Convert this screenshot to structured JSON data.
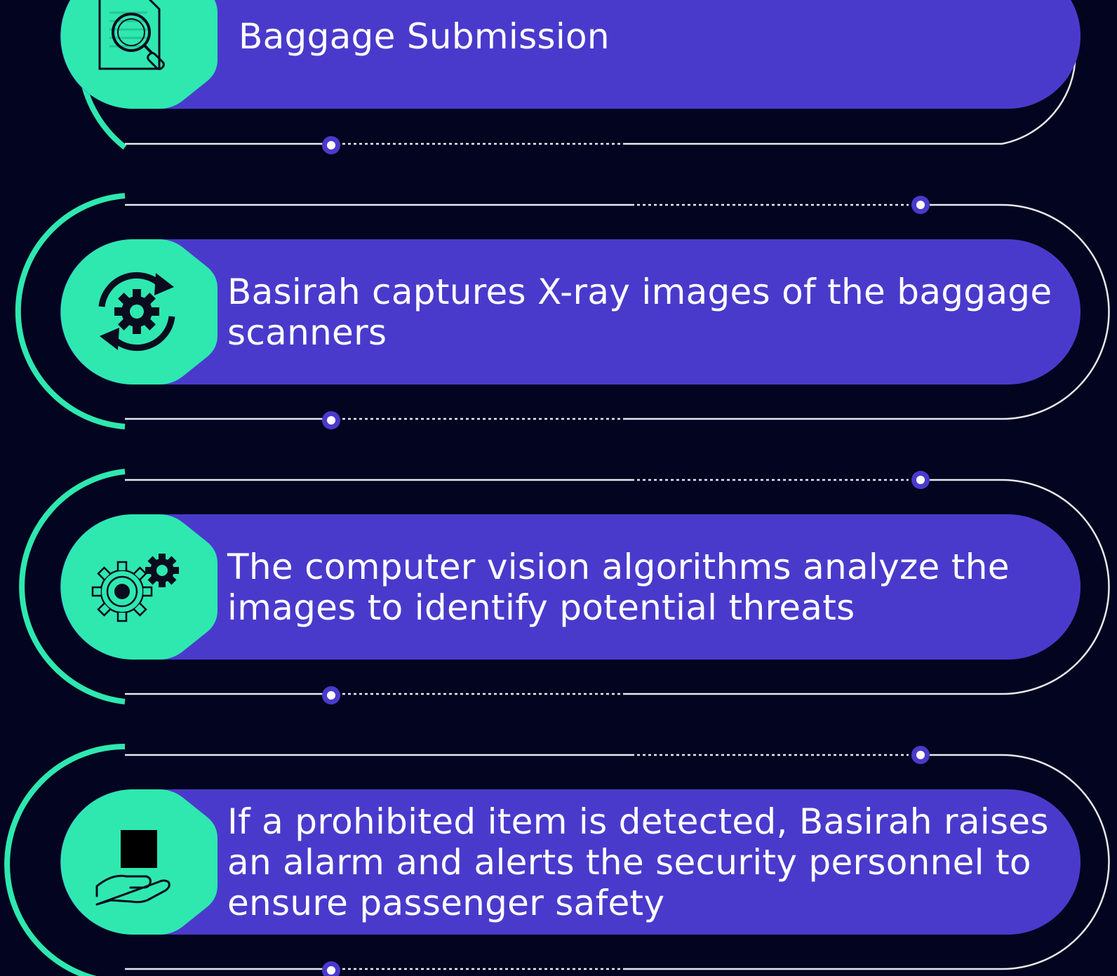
{
  "steps": [
    {
      "text": "Baggage Submission",
      "icon": "document-search-icon"
    },
    {
      "text": "Basirah captures X-ray images of the baggage scanners",
      "icon": "gear-refresh-icon"
    },
    {
      "text": "The computer vision algorithms analyze the images to identify potential threats",
      "icon": "gears-icon"
    },
    {
      "text": "If a prohibited item is detected, Basirah raises an alarm and alerts the security personnel to ensure passenger safety",
      "icon": "hand-with-item-icon"
    }
  ],
  "colors": {
    "background": "#03041f",
    "pill": "#4a3acc",
    "accent": "#2ee8b0",
    "line": "#e8e8f0",
    "node": "#4a3acc",
    "text": "#ffffff"
  }
}
